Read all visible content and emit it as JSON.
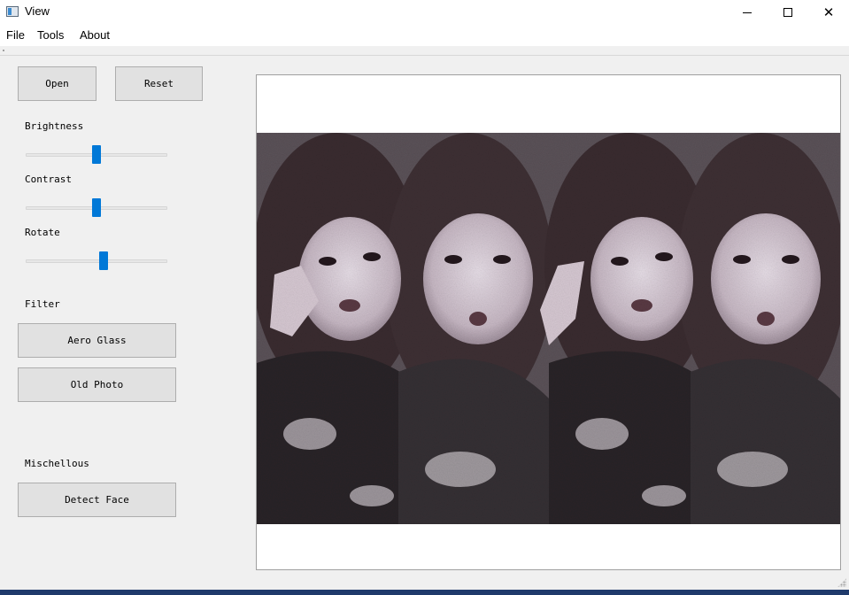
{
  "window": {
    "title": "View",
    "icon": "app-window-icon",
    "controls": {
      "minimize": "minimize-icon",
      "maximize": "maximize-icon",
      "close": "✕"
    }
  },
  "menu": {
    "file": "File",
    "tools": "Tools",
    "about": "About"
  },
  "controls": {
    "open_label": "Open",
    "reset_label": "Reset",
    "brightness_label": "Brightness",
    "contrast_label": "Contrast",
    "rotate_label": "Rotate",
    "brightness_value": 0.5,
    "contrast_value": 0.5,
    "rotate_value": 0.55
  },
  "filter": {
    "heading": "Filter",
    "aero_glass_label": "Aero Glass",
    "old_photo_label": "Old Photo"
  },
  "misc": {
    "heading": "Mischellous",
    "detect_face_label": "Detect Face"
  },
  "colors": {
    "accent": "#0078d7",
    "window_bg": "#f0f0f0",
    "button_bg": "#e1e1e1"
  }
}
